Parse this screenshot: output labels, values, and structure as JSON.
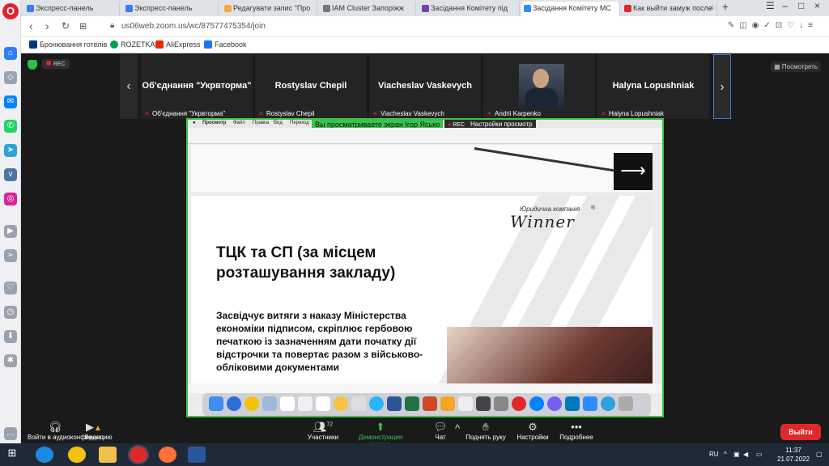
{
  "browser": {
    "tabs": [
      {
        "label": "Экспресс-панель",
        "favicon_color": "#3b7cf0"
      },
      {
        "label": "Экспресс-панель",
        "favicon_color": "#3b7cf0"
      },
      {
        "label": "Редагувати запис \"Про",
        "favicon_color": "#f2a838"
      },
      {
        "label": "IAM Cluster Запоріжж",
        "favicon_color": "#777777"
      },
      {
        "label": "Засідання Комітету під",
        "favicon_color": "#7a3ea8"
      },
      {
        "label": "Засідання Комітету МС",
        "favicon_color": "#2d8cff"
      },
      {
        "label": "Как выйти замуж после",
        "favicon_color": "#e02828"
      }
    ],
    "url": "us06web.zoom.us/wc/87577475354/join",
    "bookmarks": [
      {
        "label": "Бронювання готелів",
        "color": "#003580"
      },
      {
        "label": "ROZETKA",
        "color": "#00a046"
      },
      {
        "label": "AliExpress",
        "color": "#e62e04"
      },
      {
        "label": "Facebook",
        "color": "#1877f2"
      }
    ]
  },
  "zoom": {
    "rec_label": "REC",
    "view_label": "Посмотреть",
    "participants": [
      {
        "name": "Об'єднання \"Укрвторма\"",
        "footer": "Об'єднання \"Укрвторма\"",
        "has_video": false
      },
      {
        "name": "Rostyslav Chepil",
        "footer": "Rostyslav Chepil",
        "has_video": false
      },
      {
        "name": "Viacheslav Vaskevych",
        "footer": "Viacheslav Vaskevych",
        "has_video": false
      },
      {
        "name": "",
        "footer": "Andrii Karpenko",
        "has_video": true
      },
      {
        "name": "Halyna Lopushniak",
        "footer": "Halyna Lopushniak",
        "has_video": false
      }
    ],
    "share_banner": "Вы просматриваете экран Ігор Ясько",
    "share_rec": "REC",
    "share_settings": "Настройки просмотр",
    "slide": {
      "brand_small": "Юридична компанія",
      "brand": "Winner",
      "title": "ТЦК та СП (за місцем розташування закладу)",
      "body": "Засвідчує витяги з наказу Міністерства економіки підписом, скріплює гербовою печаткою із зазначенням дати початку дії відстрочки та повертає разом з військово-обліковими документами"
    },
    "controls": {
      "audio": "Войти в аудиоконференцию",
      "video": "Видео",
      "participants": "Участники",
      "participants_count": "72",
      "share": "Демонстрация экрана",
      "chat": "Чат",
      "raise_hand": "Поднять руку",
      "settings": "Настройки",
      "more": "Подробнее",
      "exit": "Выйти"
    }
  },
  "taskbar": {
    "lang": "RU",
    "time": "11:37",
    "date": "21.07.2022"
  }
}
